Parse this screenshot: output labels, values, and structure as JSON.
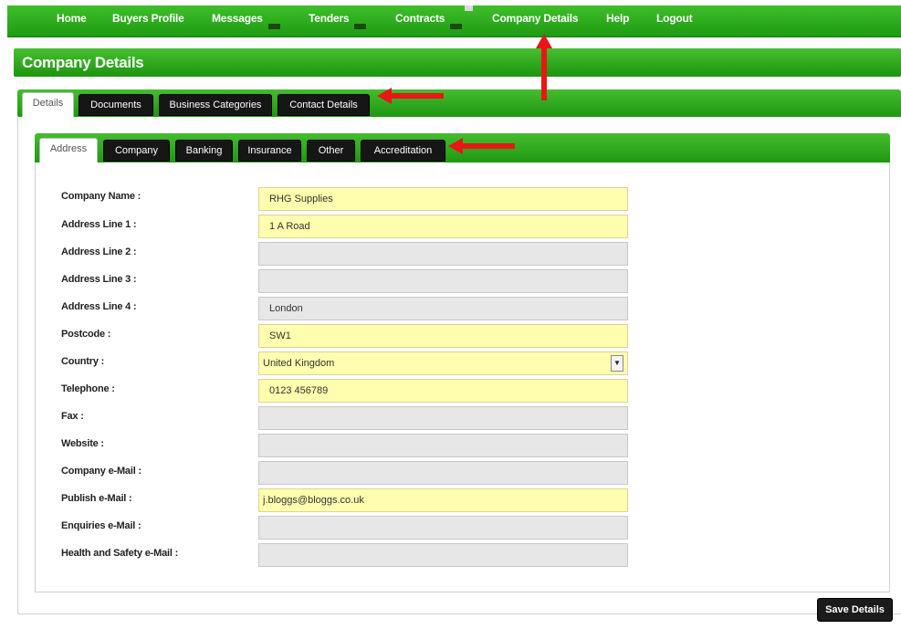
{
  "nav": {
    "items": [
      {
        "label": "Home",
        "dropdown": false
      },
      {
        "label": "Buyers Profile",
        "dropdown": false
      },
      {
        "label": "Messages",
        "dropdown": true
      },
      {
        "label": "Tenders",
        "dropdown": true
      },
      {
        "label": "Contracts",
        "dropdown": true
      },
      {
        "label": "Company Details",
        "dropdown": false
      },
      {
        "label": "Help",
        "dropdown": false
      },
      {
        "label": "Logout",
        "dropdown": false
      }
    ]
  },
  "page": {
    "title": "Company Details"
  },
  "outer_tabs": [
    {
      "label": "Details",
      "active": true
    },
    {
      "label": "Documents",
      "active": false
    },
    {
      "label": "Business Categories",
      "active": false
    },
    {
      "label": "Contact Details",
      "active": false
    }
  ],
  "inner_tabs": [
    {
      "label": "Address",
      "active": true
    },
    {
      "label": "Company",
      "active": false
    },
    {
      "label": "Banking",
      "active": false
    },
    {
      "label": "Insurance",
      "active": false
    },
    {
      "label": "Other",
      "active": false
    },
    {
      "label": "Accreditation",
      "active": false
    }
  ],
  "form": {
    "fields": [
      {
        "label": "Company Name :",
        "value": "RHG Supplies",
        "style": "yellow"
      },
      {
        "label": "Address Line 1 :",
        "value": "1 A Road",
        "style": "yellow"
      },
      {
        "label": "Address Line 2 :",
        "value": "",
        "style": "grey"
      },
      {
        "label": "Address Line 3 :",
        "value": "",
        "style": "grey"
      },
      {
        "label": "Address Line 4 :",
        "value": "London",
        "style": "grey"
      },
      {
        "label": "Postcode :",
        "value": "SW1",
        "style": "yellow"
      },
      {
        "label": "Country :",
        "value": "United Kingdom",
        "style": "yellow",
        "type": "select"
      },
      {
        "label": "Telephone :",
        "value": "0123 456789",
        "style": "yellow"
      },
      {
        "label": "Fax :",
        "value": "",
        "style": "grey"
      },
      {
        "label": "Website :",
        "value": "",
        "style": "grey"
      },
      {
        "label": "Company e-Mail :",
        "value": "",
        "style": "grey"
      },
      {
        "label": "Publish e-Mail :",
        "value": "j.bloggs@bloggs.co.uk",
        "style": "yellow"
      },
      {
        "label": "Enquiries e-Mail :",
        "value": "",
        "style": "grey"
      },
      {
        "label": "Health and Safety e-Mail :",
        "value": "",
        "style": "grey"
      }
    ]
  },
  "actions": {
    "save_label": "Save Details"
  },
  "colors": {
    "green": "#2aac1b",
    "input_yellow": "#fffdae",
    "input_grey": "#e7e7e7",
    "annotation_red": "#e81616"
  },
  "icons": {
    "dropdown": "chevron-down-icon",
    "select": "select-arrow-icon"
  }
}
